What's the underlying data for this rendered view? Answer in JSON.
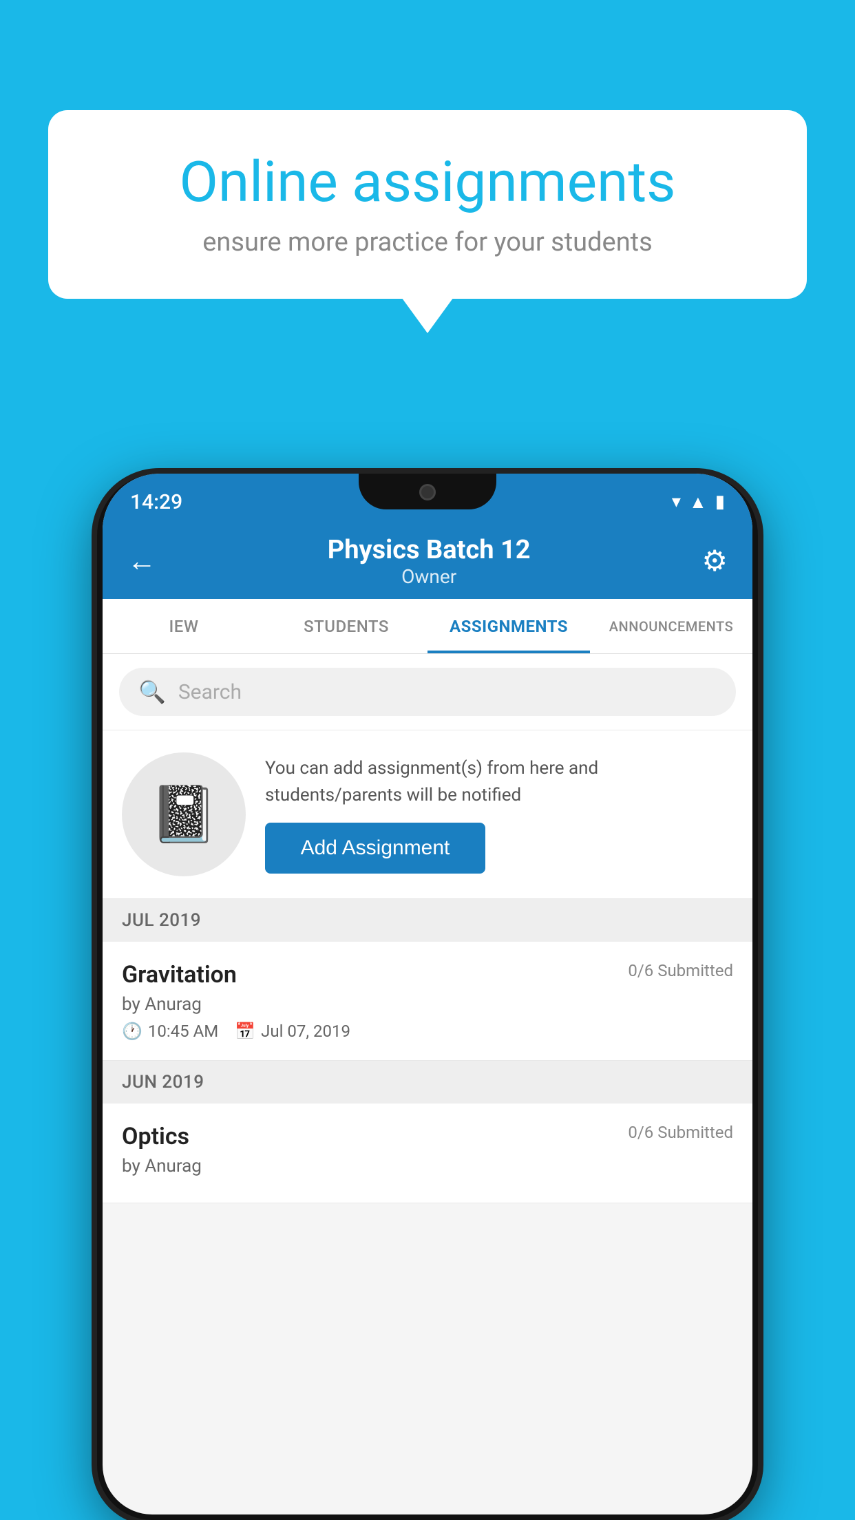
{
  "background": {
    "color": "#1ab8e8"
  },
  "speech_bubble": {
    "title": "Online assignments",
    "subtitle": "ensure more practice for your students"
  },
  "phone": {
    "status_bar": {
      "time": "14:29",
      "icons": [
        "wifi",
        "signal",
        "battery"
      ]
    },
    "header": {
      "title": "Physics Batch 12",
      "subtitle": "Owner",
      "back_label": "←",
      "gear_label": "⚙"
    },
    "tabs": [
      {
        "label": "IEW",
        "active": false
      },
      {
        "label": "STUDENTS",
        "active": false
      },
      {
        "label": "ASSIGNMENTS",
        "active": true
      },
      {
        "label": "ANNOUNCEMENTS",
        "active": false
      }
    ],
    "search": {
      "placeholder": "Search"
    },
    "promo": {
      "description": "You can add assignment(s) from here and students/parents will be notified",
      "button_label": "Add Assignment"
    },
    "sections": [
      {
        "header": "JUL 2019",
        "items": [
          {
            "name": "Gravitation",
            "submitted": "0/6 Submitted",
            "by": "by Anurag",
            "time": "10:45 AM",
            "date": "Jul 07, 2019"
          }
        ]
      },
      {
        "header": "JUN 2019",
        "items": [
          {
            "name": "Optics",
            "submitted": "0/6 Submitted",
            "by": "by Anurag",
            "time": "",
            "date": ""
          }
        ]
      }
    ]
  }
}
